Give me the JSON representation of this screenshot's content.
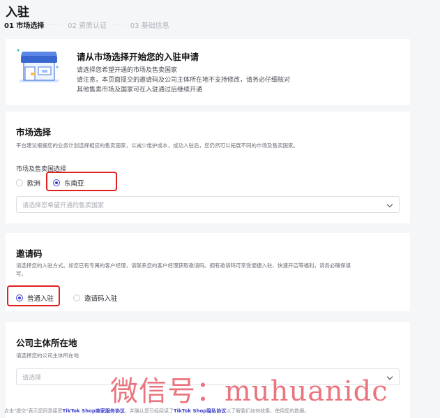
{
  "header": {
    "title": "入驻"
  },
  "steps": [
    {
      "label": "01 市场选择"
    },
    {
      "label": "02 资质认证"
    },
    {
      "label": "03 基础信息"
    }
  ],
  "steps_separator": "·····",
  "intro": {
    "title": "请从市场选择开始您的入驻申请",
    "lines": [
      "请选择您希望开通的市场及售卖国家",
      "请注意，本页面提交的邀请码及公司主体所在地不支持修改，请务必仔细核对",
      "其他售卖市场及国家可在入驻通过后继续开通"
    ]
  },
  "market": {
    "heading": "市场选择",
    "description": "平台建议根据您的业务计划选择相应的售卖国家，以减少维护成本，成功入驻后，您仍然可以拓展不同的市场及售卖国家。",
    "field_label": "市场及售卖国选择",
    "options": [
      {
        "label": "欧洲",
        "checked": false
      },
      {
        "label": "东南亚",
        "checked": true
      }
    ],
    "select_placeholder": "请选择您希望开通的售卖国家"
  },
  "invite": {
    "heading": "邀请码",
    "description_line1": "请选择您的入驻方式。如您已有专属的客户经理，请联系您的客户经理获取邀请码。拥有邀请码可享受便捷入驻、快速开店等福利，请务必确保填",
    "description_line2": "写。",
    "options": [
      {
        "label": "普通入驻",
        "checked": true
      },
      {
        "label": "邀请码入驻",
        "checked": false
      }
    ]
  },
  "company": {
    "heading": "公司主体所在地",
    "description": "请选择您的公司主体所在地",
    "select_placeholder": "请选择"
  },
  "footer": {
    "part1": "点击\"提交\"表示您同意接受",
    "link1": "TikTok Shop商家服务协议",
    "part2": "，并确认您已经阅读了",
    "link2": "TikTok Shop隐私协议",
    "part3": "以了解我们如何收集、使用您的数据。"
  },
  "watermark": "微信号：muhuanidc",
  "colors": {
    "accent": "#3b3ec9",
    "highlight": "#e02020",
    "watermark": "#e85c68"
  }
}
